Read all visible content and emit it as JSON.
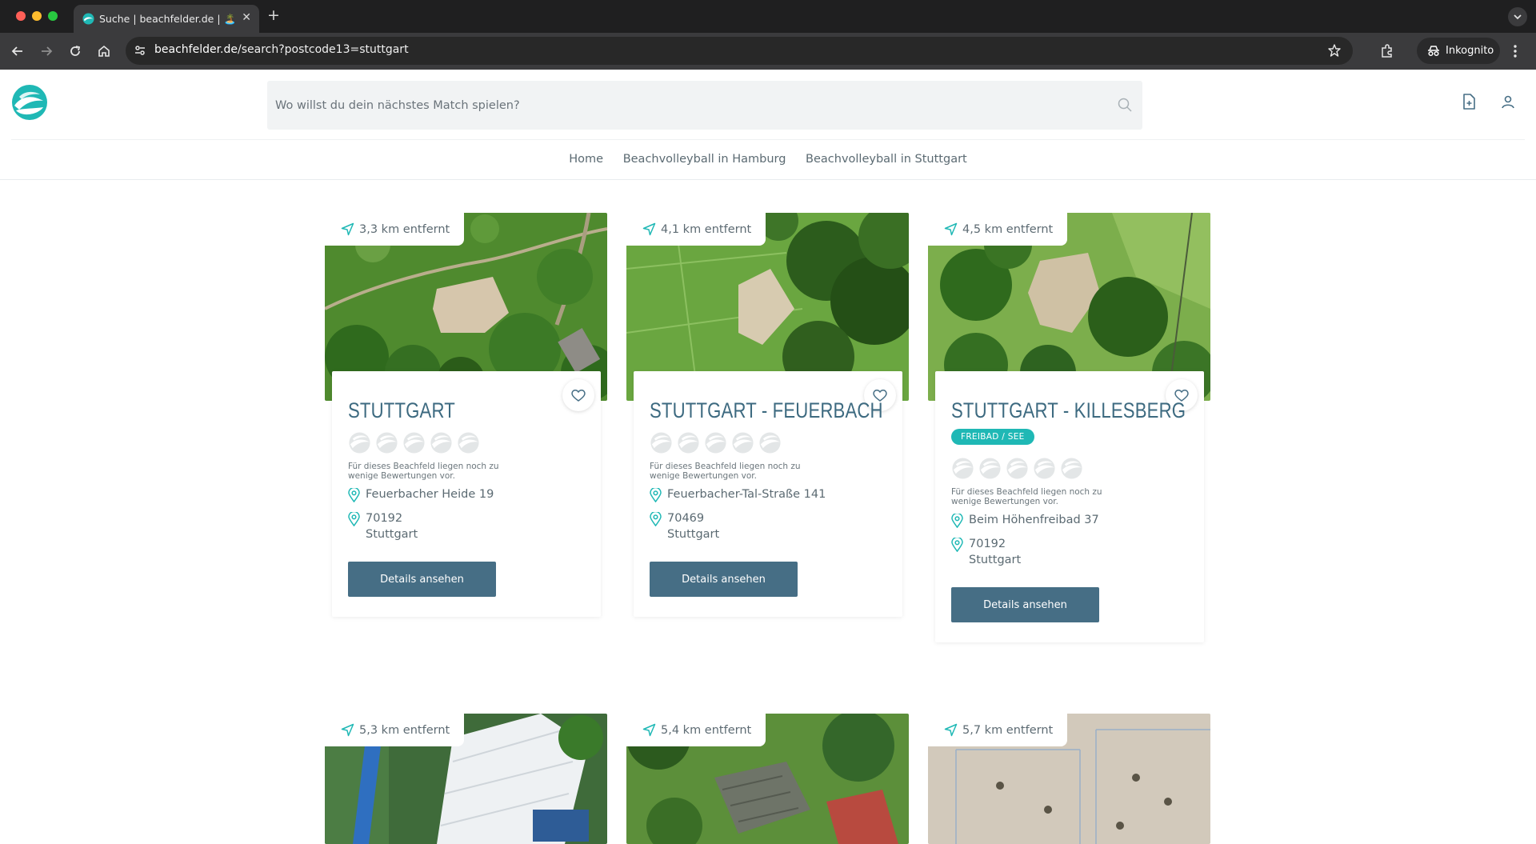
{
  "browser": {
    "tab_title": "Suche | beachfelder.de | 🏝️ D",
    "url_host": "beachfelder.de",
    "url_path": "/search?postcode13=stuttgart",
    "incognito_label": "Inkognito"
  },
  "header": {
    "search_placeholder": "Wo willst du dein nächstes Match spielen?",
    "nav": [
      {
        "label": "Home"
      },
      {
        "label": "Beachvolleyball in Hamburg"
      },
      {
        "label": "Beachvolleyball in Stuttgart"
      }
    ]
  },
  "colors": {
    "accent": "#1fb8b5",
    "title": "#3d6a80",
    "button": "#466e85"
  },
  "results": [
    {
      "distance": "3,3 km entfernt",
      "title": "STUTTGART",
      "badge": "",
      "rating_note": "Für dieses Beachfeld liegen noch zu wenige Bewertungen vor.",
      "street": "Feuerbacher Heide 19",
      "postcode": "70192",
      "city": "Stuttgart",
      "button": "Details ansehen"
    },
    {
      "distance": "4,1 km entfernt",
      "title": "STUTTGART - FEUERBACH",
      "badge": "",
      "rating_note": "Für dieses Beachfeld liegen noch zu wenige Bewertungen vor.",
      "street": "Feuerbacher-Tal-Straße 141",
      "postcode": "70469",
      "city": "Stuttgart",
      "button": "Details ansehen"
    },
    {
      "distance": "4,5 km entfernt",
      "title": "STUTTGART - KILLESBERG",
      "badge": "FREIBAD / SEE",
      "rating_note": "Für dieses Beachfeld liegen noch zu wenige Bewertungen vor.",
      "street": "Beim Höhenfreibad 37",
      "postcode": "70192",
      "city": "Stuttgart",
      "button": "Details ansehen"
    },
    {
      "distance": "5,3 km entfernt"
    },
    {
      "distance": "5,4 km entfernt"
    },
    {
      "distance": "5,7 km entfernt"
    }
  ]
}
